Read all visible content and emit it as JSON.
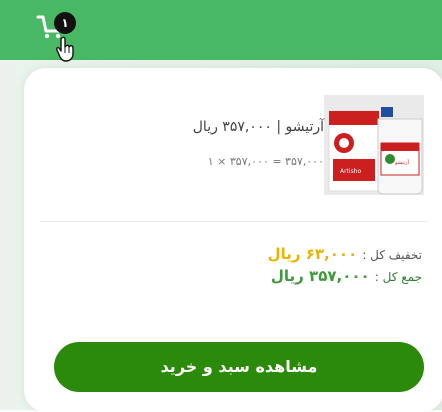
{
  "header": {
    "cart_count": "۱"
  },
  "cart_item": {
    "name_price": "آرتیشو | ۳۵۷,۰۰۰ ریال",
    "quantity_line": "۱ × ۳۵۷,۰۰۰ = ۳۵۷,۰۰۰",
    "image_label": "آرتیشو",
    "image_logo_text": "Artisho"
  },
  "summary": {
    "discount_label": "تخفیف کل :",
    "discount_value": "۶۳,۰۰۰ ریال",
    "total_label": "جمع کل :",
    "total_value": "۳۵۷,۰۰۰ ریال"
  },
  "actions": {
    "checkout_label": "مشاهده سبد و خرید"
  },
  "colors": {
    "topbar": "#48b865",
    "checkout_button": "#2b8a0a",
    "discount_value": "#e8b400",
    "total_value": "#3f9b3a"
  },
  "icons": {
    "cart": "cart-icon",
    "cursor": "hand-pointer-icon"
  }
}
